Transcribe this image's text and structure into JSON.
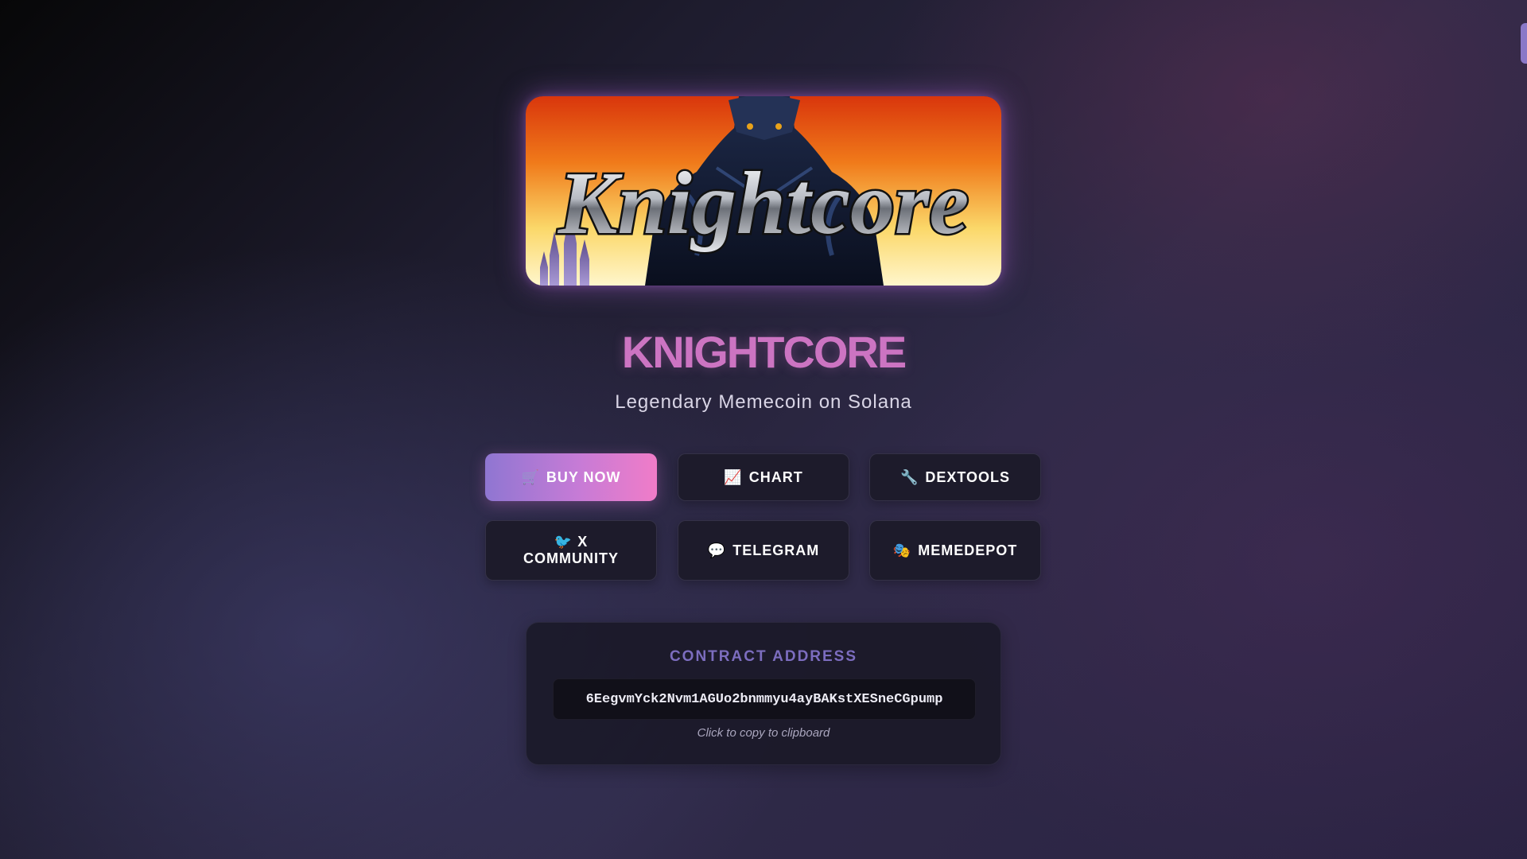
{
  "banner": {
    "logo_text": "Knightcore"
  },
  "title": "KNIGHTCORE",
  "subtitle": "Legendary Memecoin on Solana",
  "buttons": [
    {
      "icon": "🛒",
      "icon_name": "cart-icon",
      "label": "BUY NOW"
    },
    {
      "icon": "📈",
      "icon_name": "chart-icon",
      "label": "CHART"
    },
    {
      "icon": "🔧",
      "icon_name": "wrench-icon",
      "label": "DEXTOOLS"
    },
    {
      "icon": "🐦",
      "icon_name": "bird-icon",
      "label_line1": "X",
      "label_line2": "COMMUNITY"
    },
    {
      "icon": "💬",
      "icon_name": "speech-bubble-icon",
      "label": "TELEGRAM"
    },
    {
      "icon": "🎭",
      "icon_name": "theater-masks-icon",
      "label": "MEMEDEPOT"
    }
  ],
  "contract": {
    "title": "CONTRACT ADDRESS",
    "address": "6EegvmYck2Nvm1AGUo2bnmmyu4ayBAKstXESneCGpump",
    "hint": "Click to copy to clipboard"
  },
  "colors": {
    "accent": "#cc74c2",
    "primary_gradient_start": "#8f76d2",
    "primary_gradient_end": "#f07cc8",
    "card_title": "#7c6dbf"
  }
}
